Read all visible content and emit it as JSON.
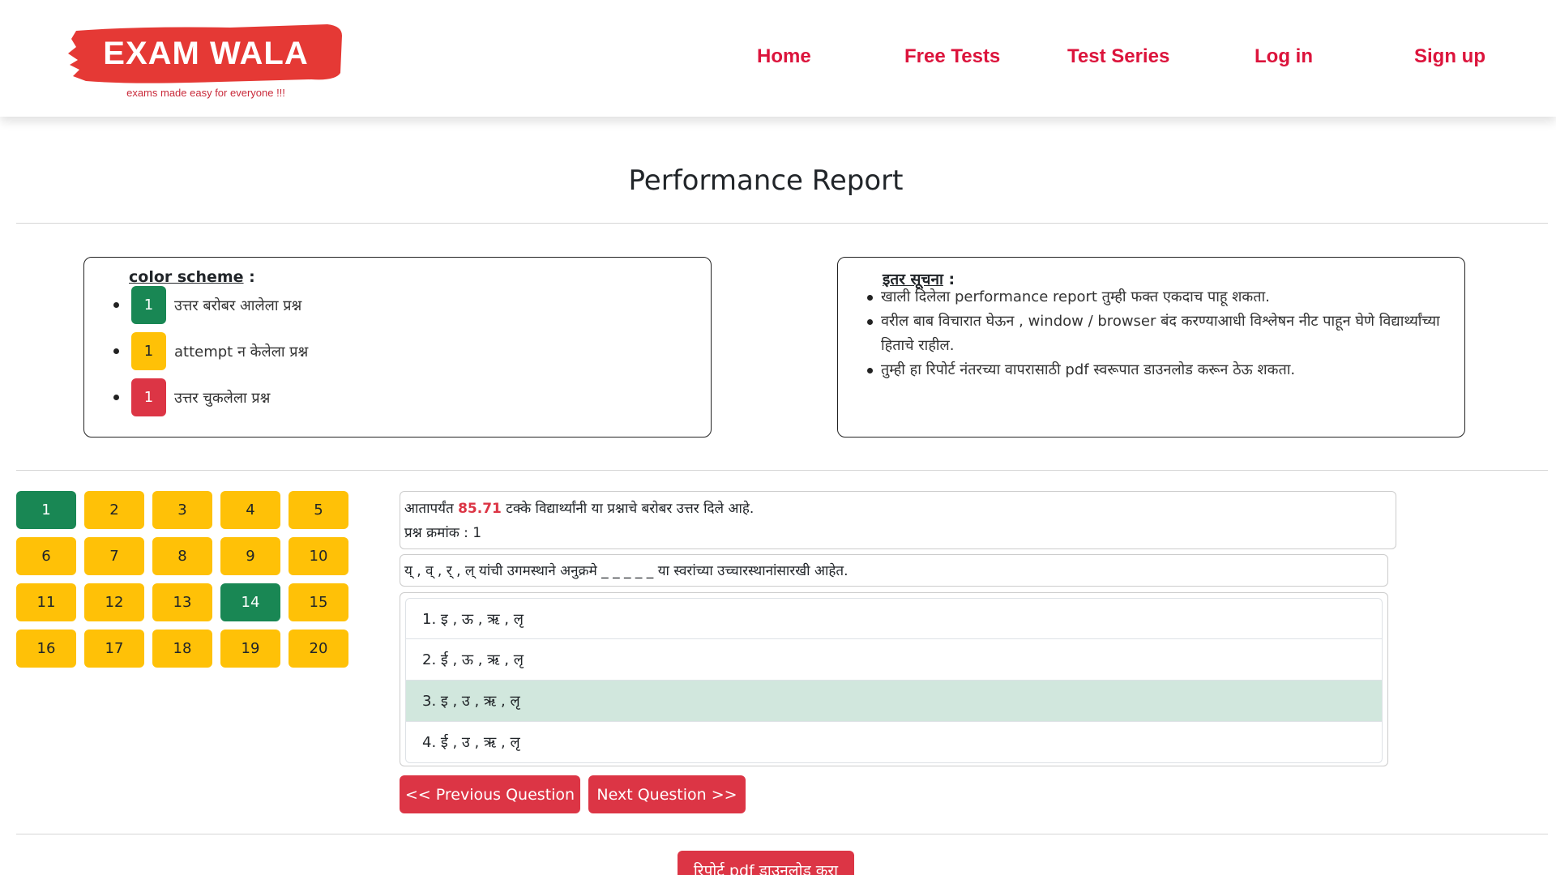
{
  "brand": {
    "name": "EXAM WALA",
    "tagline": "exams made easy for everyone !!!",
    "color": "#e53935"
  },
  "nav": {
    "home": "Home",
    "free_tests": "Free Tests",
    "test_series": "Test Series",
    "login": "Log in",
    "signup": "Sign up"
  },
  "page_title": "Performance Report",
  "color_scheme": {
    "heading": "color scheme",
    "heading_suffix": " :",
    "items": [
      {
        "chip": "1",
        "color": "#198754",
        "label": "उत्तर बरोबर आलेला प्रश्न"
      },
      {
        "chip": "1",
        "color": "#ffc107",
        "label": "attempt न केलेला प्रश्न"
      },
      {
        "chip": "1",
        "color": "#dc3545",
        "label": "उत्तर चुकलेला प्रश्न"
      }
    ]
  },
  "other_notes": {
    "heading": "इतर सूचना",
    "heading_suffix": " :",
    "items": [
      "खाली दिलेला performance report तुम्ही फक्त एकदाच पाहू शकता.",
      "वरील बाब विचारात घेऊन , window / browser बंद करण्याआधी विश्लेषन नीट पाहून घेणे विद्यार्थ्यांच्या हिताचे राहील.",
      "तुम्ही हा रिपोर्ट नंतरच्या वापरासाठी pdf स्वरूपात डाउनलोड करून ठेऊ शकता."
    ]
  },
  "questions": [
    {
      "n": "1",
      "status": "green"
    },
    {
      "n": "2",
      "status": "yellow"
    },
    {
      "n": "3",
      "status": "yellow"
    },
    {
      "n": "4",
      "status": "yellow"
    },
    {
      "n": "5",
      "status": "yellow"
    },
    {
      "n": "6",
      "status": "yellow"
    },
    {
      "n": "7",
      "status": "yellow"
    },
    {
      "n": "8",
      "status": "yellow"
    },
    {
      "n": "9",
      "status": "yellow"
    },
    {
      "n": "10",
      "status": "yellow"
    },
    {
      "n": "11",
      "status": "yellow"
    },
    {
      "n": "12",
      "status": "yellow"
    },
    {
      "n": "13",
      "status": "yellow"
    },
    {
      "n": "14",
      "status": "green"
    },
    {
      "n": "15",
      "status": "yellow"
    },
    {
      "n": "16",
      "status": "yellow"
    },
    {
      "n": "17",
      "status": "yellow"
    },
    {
      "n": "18",
      "status": "yellow"
    },
    {
      "n": "19",
      "status": "yellow"
    },
    {
      "n": "20",
      "status": "yellow"
    }
  ],
  "stats": {
    "prefix": "आतापर्यंत ",
    "percent": "85.71",
    "suffix": " टक्के विद्यार्थ्यांनी या प्रश्नाचे बरोबर उत्तर दिले आहे.",
    "question_no_label": "प्रश्न क्रमांक : 1"
  },
  "question_text": "य् , व् , र् , ल् यांची उगमस्थाने अनुक्रमे _ _ _ _ _ या स्वरांच्या उच्चारस्थानांसारखी आहेत.",
  "options": [
    {
      "text": "1. इ , ऊ , ऋ , लृ",
      "correct": false
    },
    {
      "text": "2. ई , ऊ , ऋ , लृ",
      "correct": false
    },
    {
      "text": "3. इ , उ , ऋ , लृ",
      "correct": true
    },
    {
      "text": "4. ई , उ , ऋ , लृ",
      "correct": false
    }
  ],
  "buttons": {
    "previous": "<< Previous Question",
    "next": "Next Question >>",
    "download": "रिपोर्ट pdf डाउनलोड करा"
  },
  "colors": {
    "accent": "#dc3545",
    "nav_link": "#dc143c",
    "correct": "#198754",
    "unattempted": "#ffc107",
    "wrong": "#dc3545",
    "correct_option_bg": "#d1e7dd"
  }
}
